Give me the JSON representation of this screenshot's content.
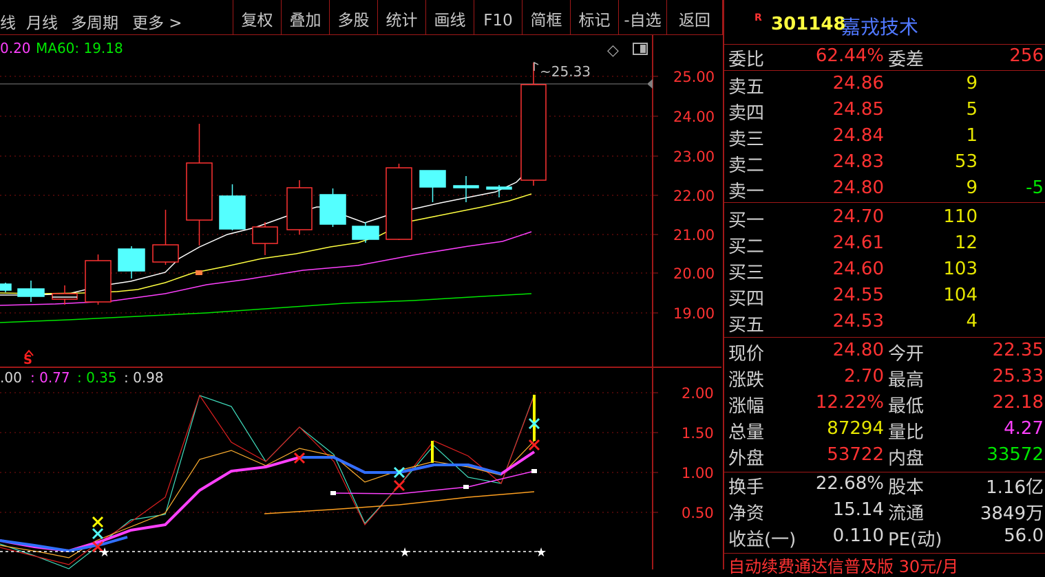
{
  "toolbar": {
    "left_items": [
      "线",
      "月线",
      "多周期",
      "更多 >"
    ],
    "buttons": [
      "复权",
      "叠加",
      "多股",
      "统计",
      "画线",
      "F10",
      "简框",
      "标记",
      "-自选",
      "返回"
    ]
  },
  "main_chart": {
    "ma_legend_partial": "0.20",
    "ma60_label": "MA60: 19.18",
    "high_marker": "25.33",
    "y_ticks": [
      "25.00",
      "24.00",
      "23.00",
      "22.00",
      "21.00",
      "20.00",
      "19.00"
    ],
    "signal_label": "S",
    "diamond_icon": "◇",
    "window_icon": "◫"
  },
  "indicator": {
    "legend": [
      ".00",
      ": 0.77",
      ": 0.35",
      ": 0.98"
    ],
    "y_ticks": [
      "2.00",
      "1.50",
      "1.00",
      "0.50"
    ]
  },
  "stock": {
    "flag": "R",
    "code": "301148",
    "name": "嘉戎技术"
  },
  "order_book": {
    "weibi_label": "委比",
    "weibi_value": "62.44%",
    "weicha_label": "委差",
    "weicha_value": "256",
    "asks": [
      {
        "label": "卖五",
        "price": "24.86",
        "vol": "9",
        "chg": ""
      },
      {
        "label": "卖四",
        "price": "24.85",
        "vol": "5",
        "chg": ""
      },
      {
        "label": "卖三",
        "price": "24.84",
        "vol": "1",
        "chg": ""
      },
      {
        "label": "卖二",
        "price": "24.83",
        "vol": "53",
        "chg": ""
      },
      {
        "label": "卖一",
        "price": "24.80",
        "vol": "9",
        "chg": "-5"
      }
    ],
    "bids": [
      {
        "label": "买一",
        "price": "24.70",
        "vol": "110"
      },
      {
        "label": "买二",
        "price": "24.61",
        "vol": "12"
      },
      {
        "label": "买三",
        "price": "24.60",
        "vol": "103"
      },
      {
        "label": "买四",
        "price": "24.55",
        "vol": "104"
      },
      {
        "label": "买五",
        "price": "24.53",
        "vol": "4"
      }
    ]
  },
  "quote": {
    "rows": [
      {
        "l1": "现价",
        "v1": "24.80",
        "c1": "red",
        "l2": "今开",
        "v2": "22.35",
        "c2": "red"
      },
      {
        "l1": "涨跌",
        "v1": "2.70",
        "c1": "red",
        "l2": "最高",
        "v2": "25.33",
        "c2": "red"
      },
      {
        "l1": "涨幅",
        "v1": "12.22%",
        "c1": "red",
        "l2": "最低",
        "v2": "22.18",
        "c2": "red"
      },
      {
        "l1": "总量",
        "v1": "87294",
        "c1": "yel",
        "l2": "量比",
        "v2": "4.27",
        "c2": "mag"
      },
      {
        "l1": "外盘",
        "v1": "53722",
        "c1": "red",
        "l2": "内盘",
        "v2": "33572",
        "c2": "grn"
      }
    ],
    "rows2": [
      {
        "l1": "换手",
        "v1": "22.68%",
        "l2": "股本",
        "v2": "1.16亿"
      },
      {
        "l1": "净资",
        "v1": "15.14",
        "l2": "流通",
        "v2": "3849万"
      },
      {
        "l1": "收益(一)",
        "v1": "0.110",
        "l2": "PE(动)",
        "v2": "56.0"
      }
    ]
  },
  "footer_ad": "自动续费通达信普及版 30元/月",
  "colors": {
    "border": "#a01818",
    "up": "#ff3232",
    "down": "#54ffff",
    "ma_white": "#ffffff",
    "ma_yellow": "#ffff40",
    "ma_magenta": "#ff40ff",
    "ma_green": "#00e600"
  }
}
